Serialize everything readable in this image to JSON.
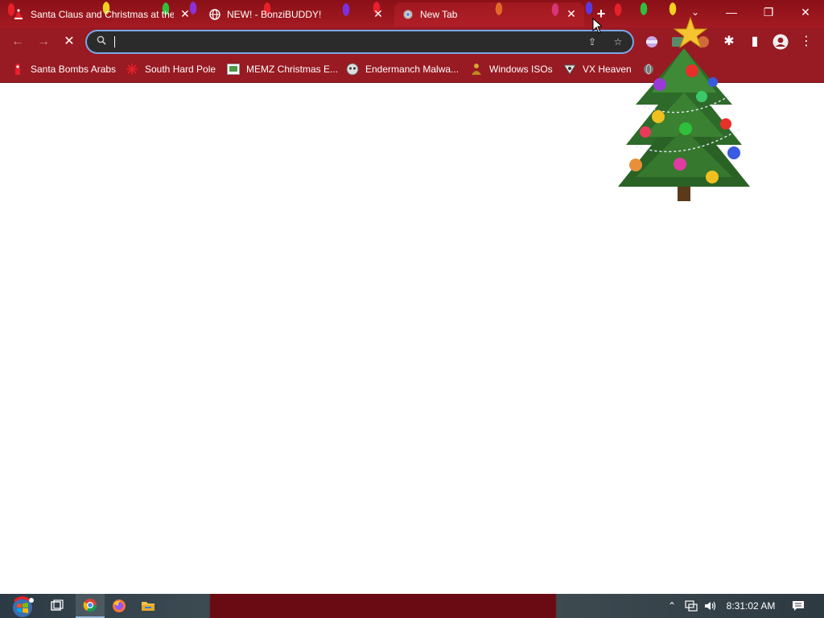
{
  "tabs": [
    {
      "title": "Santa Claus and Christmas at the",
      "favicon": "santa-favicon",
      "close": "✕"
    },
    {
      "title": "NEW! - BonziBUDDY!",
      "favicon": "globe-icon",
      "close": "✕"
    },
    {
      "title": "New Tab",
      "favicon": "chrome-icon",
      "close": "✕",
      "active": true
    }
  ],
  "tabstrip": {
    "new_tab": "+",
    "tab_search": "⌄"
  },
  "window": {
    "minimize": "—",
    "restore": "❐",
    "close": "✕"
  },
  "toolbar": {
    "back": "←",
    "forward": "→",
    "stop": "✕",
    "omnibox": {
      "value": "",
      "placeholder": ""
    },
    "share": "⇪",
    "bookmark": "☆",
    "extensions": "✱",
    "sidepanel": "▮",
    "profile": "●",
    "menu": "⋮"
  },
  "bookmarks": [
    {
      "label": "Santa Bombs Arabs",
      "icon": "santa-icon"
    },
    {
      "label": "South Hard Pole",
      "icon": "snowflake-icon"
    },
    {
      "label": "MEMZ Christmas E...",
      "icon": "memz-icon"
    },
    {
      "label": "Endermanch Malwa...",
      "icon": "endermanch-icon"
    },
    {
      "label": "Windows ISOs",
      "icon": "buddha-icon"
    },
    {
      "label": "VX Heaven",
      "icon": "vx-icon"
    },
    {
      "label": "",
      "icon": "globe-icon"
    }
  ],
  "taskbar": {
    "clock": "8:31:02 AM",
    "tray_chevron": "⌃",
    "items": [
      "start-button",
      "task-view-icon",
      "chrome-icon",
      "firefox-icon",
      "file-explorer-icon"
    ]
  },
  "colors": {
    "frame": "#981a22",
    "tab_strip": "#8a1017",
    "omnibox": "#2b2b2b",
    "focus_ring": "#7aa7e8"
  }
}
